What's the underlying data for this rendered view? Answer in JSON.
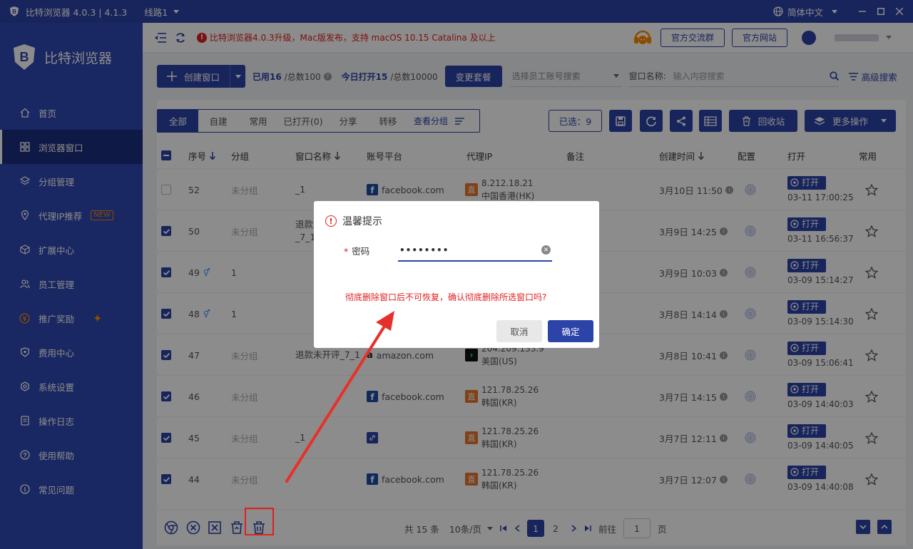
{
  "window": {
    "title": "比特浏览器 4.0.3 | 4.1.3",
    "line": "线路1",
    "language": "简体中文"
  },
  "sidebar": {
    "brand": "比特浏览器",
    "items": [
      {
        "label": "首页",
        "icon": "home-icon"
      },
      {
        "label": "浏览器窗口",
        "icon": "grid-icon",
        "active": true
      },
      {
        "label": "分组管理",
        "icon": "layers-icon"
      },
      {
        "label": "代理IP推荐",
        "icon": "location-icon",
        "badge": "NEW"
      },
      {
        "label": "扩展中心",
        "icon": "cube-icon"
      },
      {
        "label": "员工管理",
        "icon": "users-icon"
      },
      {
        "label": "推广奖励",
        "icon": "yen-icon"
      },
      {
        "label": "费用中心",
        "icon": "shield-icon"
      },
      {
        "label": "系统设置",
        "icon": "gear-icon"
      },
      {
        "label": "操作日志",
        "icon": "log-icon"
      },
      {
        "label": "使用帮助",
        "icon": "help-icon"
      },
      {
        "label": "常见问题",
        "icon": "info-icon"
      }
    ]
  },
  "topbar": {
    "notice": "比特浏览器4.0.3升级，Mac版发布，支持 macOS 10.15 Catalina 及以上",
    "group_btn": "官方交流群",
    "site_btn": "官方网站"
  },
  "toolbar": {
    "create": "创建窗口",
    "used_label": "已用16",
    "used_total": "/总数100",
    "today_label": "今日打开15",
    "today_total": "/总数10000",
    "change_plan": "变更套餐",
    "staff_placeholder": "选择员工账号搜索",
    "window_name_label": "窗口名称:",
    "window_name_placeholder": "输入内容搜索",
    "advanced": "高级搜索"
  },
  "tabs": [
    "全部",
    "自建",
    "常用",
    "已打开(0)",
    "分享",
    "转移"
  ],
  "view_group": "查看分组",
  "selected": "已选：9",
  "recycle": "回收站",
  "more": "更多操作",
  "columns": {
    "seq": "序号",
    "group": "分组",
    "name": "窗口名称",
    "platform": "账号平台",
    "proxy": "代理IP",
    "note": "备注",
    "created": "创建时间",
    "config": "配置",
    "open": "打开",
    "fav": "常用"
  },
  "rows": [
    {
      "checked": false,
      "seq": "52",
      "gender": "",
      "group": "未分组",
      "group_gray": true,
      "name": "_1",
      "name2": "",
      "platform": "facebook.com",
      "ptype": "fb",
      "ip": "8.212.18.21",
      "loc": "中国香港(HK)",
      "itype": "直",
      "created": "3月10日 11:50",
      "open_label": "打开",
      "open_time": "03-11 17:00:25"
    },
    {
      "checked": true,
      "seq": "50",
      "gender": "",
      "group": "未分组",
      "group_gray": true,
      "name": "退款未",
      "name2": "_7_1",
      "platform": "",
      "ptype": "",
      "ip": "",
      "loc": "",
      "itype": "",
      "created": "3月9日 14:25",
      "open_label": "打开",
      "open_time": "03-11 16:56:37"
    },
    {
      "checked": true,
      "seq": "49",
      "gender": "⚥",
      "group": "1",
      "group_gray": false,
      "name": "",
      "name2": "",
      "platform": "",
      "ptype": "",
      "ip": "",
      "loc": "",
      "itype": "",
      "created": "3月9日 10:03",
      "open_label": "打开",
      "open_time": "03-09 15:14:27"
    },
    {
      "checked": true,
      "seq": "48",
      "gender": "⚥",
      "group": "1",
      "group_gray": false,
      "name": "",
      "name2": "",
      "platform": "",
      "ptype": "",
      "ip": "",
      "loc": "",
      "itype": "",
      "created": "3月8日 14:14",
      "open_label": "打开",
      "open_time": "03-09 15:14:30"
    },
    {
      "checked": true,
      "seq": "47",
      "gender": "",
      "group": "未分组",
      "group_gray": true,
      "name": "退款未开评_7_1",
      "name2": "",
      "platform": "amazon.com",
      "ptype": "az",
      "ip": "204.209.133.9",
      "loc": "美国(US)",
      "itype": "X",
      "created": "3月8日 10:41",
      "open_label": "打开",
      "open_time": "03-09 15:06:41"
    },
    {
      "checked": true,
      "seq": "46",
      "gender": "",
      "group": "未分组",
      "group_gray": true,
      "name": "",
      "name2": "",
      "platform": "facebook.com",
      "ptype": "fb",
      "ip": "121.78.25.26",
      "loc": "韩国(KR)",
      "itype": "直",
      "created": "3月7日 14:15",
      "open_label": "打开",
      "open_time": "03-09 14:40:03"
    },
    {
      "checked": true,
      "seq": "45",
      "gender": "",
      "group": "未分组",
      "group_gray": true,
      "name": "_1",
      "name2": "",
      "platform": "",
      "ptype": "link",
      "ip": "121.78.25.26",
      "loc": "韩国(KR)",
      "itype": "直",
      "created": "3月7日 12:11",
      "open_label": "打开",
      "open_time": "03-09 14:40:05"
    },
    {
      "checked": true,
      "seq": "44",
      "gender": "",
      "group": "未分组",
      "group_gray": true,
      "name": "",
      "name2": "",
      "platform": "facebook.com",
      "ptype": "fb",
      "ip": "121.78.25.26",
      "loc": "韩国(KR)",
      "itype": "直",
      "created": "3月7日 12:07",
      "open_label": "打开",
      "open_time": "03-09 14:40:08"
    }
  ],
  "pager": {
    "total": "共 15 条",
    "per_page": "10条/页",
    "pages": [
      "1",
      "2"
    ],
    "goto": "前往",
    "goto_value": "1",
    "page_unit": "页"
  },
  "dialog": {
    "title": "温馨提示",
    "password_label": "密码",
    "password_value": "••••••••",
    "warning": "彻底删除窗口后不可恢复，确认彻底删除所选窗口吗?",
    "cancel": "取消",
    "confirm": "确定"
  },
  "colors": {
    "primary": "#2c43a8",
    "danger": "#e02020",
    "sidebar": "#2e47b3"
  }
}
